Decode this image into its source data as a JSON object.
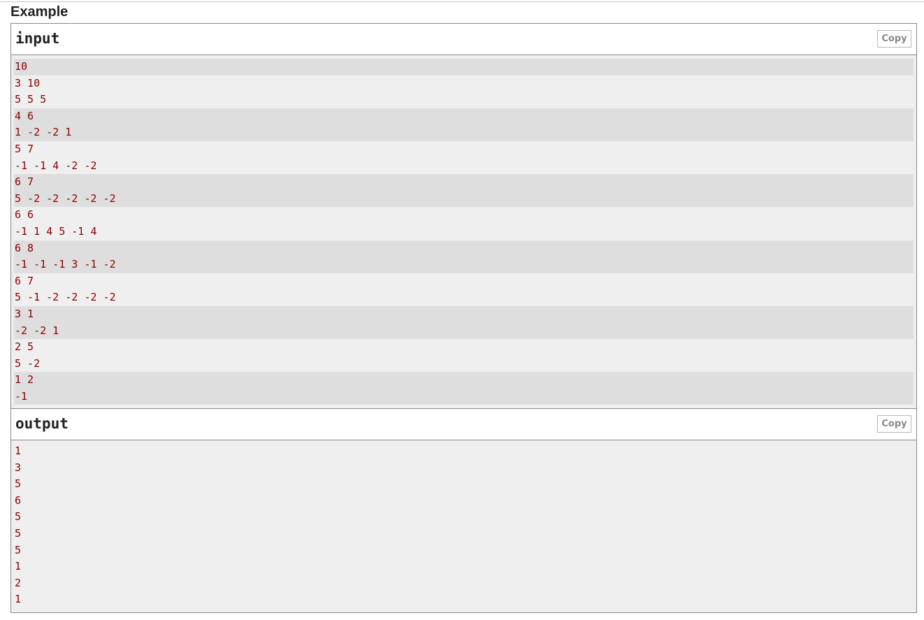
{
  "section": {
    "title": "Example"
  },
  "input": {
    "title": "input",
    "copy_label": "Copy",
    "lines": [
      "10",
      "3 10",
      "5 5 5",
      "4 6",
      "1 -2 -2 1",
      "5 7",
      "-1 -1 4 -2 -2",
      "6 7",
      "5 -2 -2 -2 -2 -2",
      "6 6",
      "-1 1 4 5 -1 4",
      "6 8",
      "-1 -1 -1 3 -1 -2",
      "6 7",
      "5 -1 -2 -2 -2 -2",
      "3 1",
      "-2 -2 1",
      "2 5",
      "5 -2",
      "1 2",
      "-1"
    ],
    "row_groups": [
      0,
      1,
      1,
      2,
      2,
      3,
      3,
      4,
      4,
      5,
      5,
      6,
      6,
      7,
      7,
      8,
      8,
      9,
      9,
      10,
      10
    ]
  },
  "output": {
    "title": "output",
    "copy_label": "Copy",
    "lines": [
      "1",
      "3",
      "5",
      "6",
      "5",
      "5",
      "5",
      "1",
      "2",
      "1"
    ]
  },
  "colors": {
    "text": "#8b0000",
    "stripe": "#dedede",
    "background": "#efefef",
    "border": "#888888"
  }
}
